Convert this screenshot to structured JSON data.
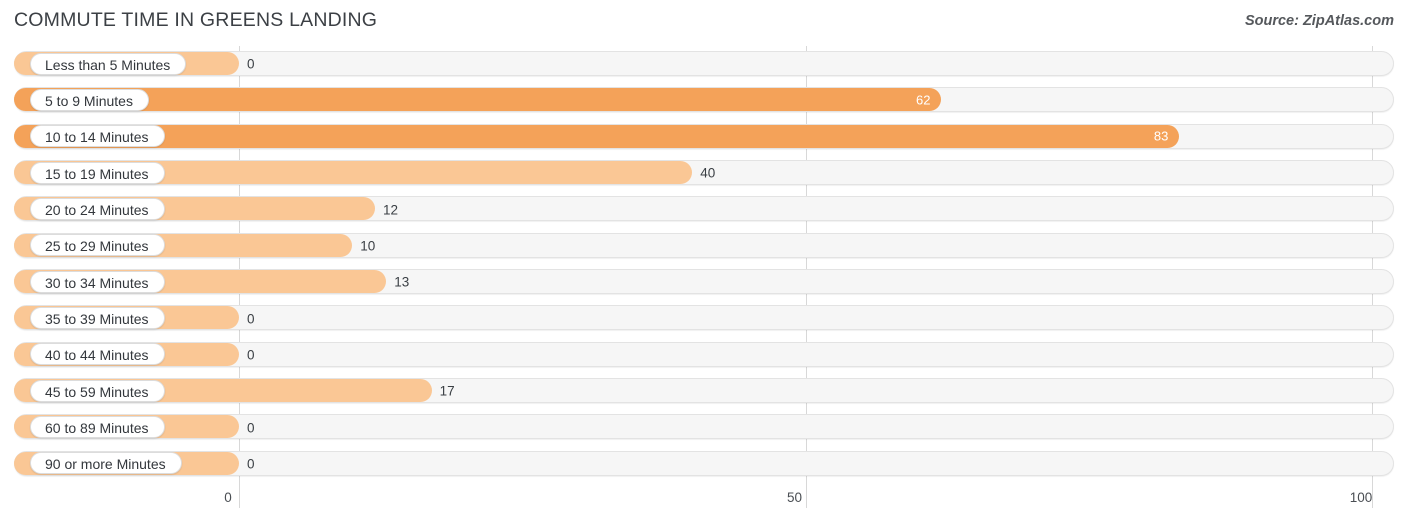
{
  "header": {
    "title": "COMMUTE TIME IN GREENS LANDING",
    "source": "Source: ZipAtlas.com"
  },
  "colors": {
    "bar_strong": "#f4a259",
    "bar_light": "#fac795",
    "track": "#f6f6f6",
    "grid": "#d8d8d8",
    "text": "#3a3f44"
  },
  "chart_data": {
    "type": "bar",
    "orientation": "horizontal",
    "title": "COMMUTE TIME IN GREENS LANDING",
    "xlabel": "",
    "ylabel": "",
    "xlim": [
      0,
      100
    ],
    "grid": true,
    "legend": null,
    "xticks": [
      0,
      50,
      100
    ],
    "xtick_labels": [
      "0",
      "50",
      "100"
    ],
    "categories": [
      "Less than 5 Minutes",
      "5 to 9 Minutes",
      "10 to 14 Minutes",
      "15 to 19 Minutes",
      "20 to 24 Minutes",
      "25 to 29 Minutes",
      "30 to 34 Minutes",
      "35 to 39 Minutes",
      "40 to 44 Minutes",
      "45 to 59 Minutes",
      "60 to 89 Minutes",
      "90 or more Minutes"
    ],
    "values": [
      0,
      62,
      83,
      40,
      12,
      10,
      13,
      0,
      0,
      17,
      0,
      0
    ],
    "value_labels": [
      "0",
      "62",
      "83",
      "40",
      "12",
      "10",
      "13",
      "0",
      "0",
      "17",
      "0",
      "0"
    ]
  }
}
